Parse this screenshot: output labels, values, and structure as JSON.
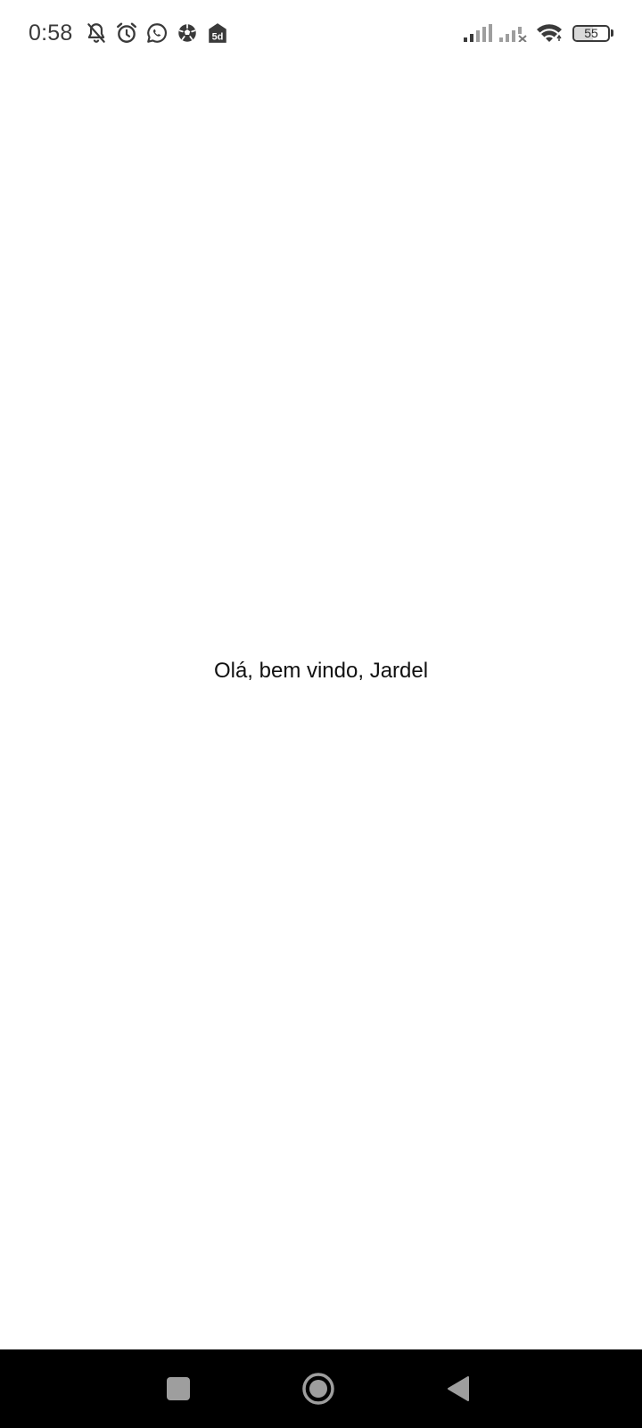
{
  "status_bar": {
    "time": "0:58",
    "left_icons": [
      "bell-off-icon",
      "alarm-icon",
      "whatsapp-icon",
      "soccer-ball-icon",
      "app-5d-icon"
    ],
    "badge_text": "5d",
    "battery_level": "55",
    "battery_percent": 55
  },
  "main": {
    "welcome_text": "Olá, bem vindo, Jardel"
  },
  "nav_bar": {
    "buttons": [
      "recents-button",
      "home-button",
      "back-button"
    ]
  },
  "colors": {
    "background": "#ffffff",
    "status_icon": "#3a3a3a",
    "nav_background": "#000000",
    "nav_icon": "#9e9e9e"
  }
}
